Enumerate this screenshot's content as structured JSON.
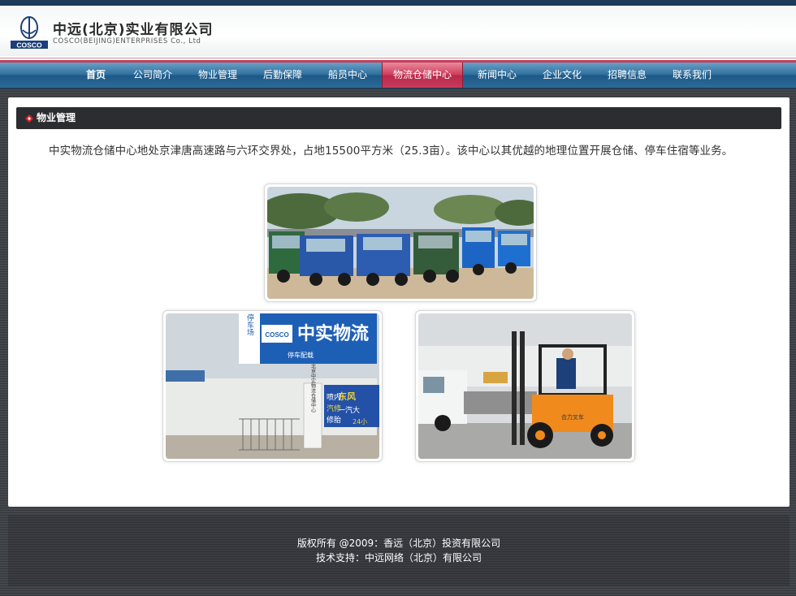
{
  "header": {
    "company_name_cn": "中远(北京)实业有限公司",
    "company_name_en": "COSCO(BEIJING)ENTERPRISES Co., Ltd",
    "logo_text": "COSCO"
  },
  "nav": {
    "items": [
      {
        "label": "首页"
      },
      {
        "label": "公司简介"
      },
      {
        "label": "物业管理"
      },
      {
        "label": "后勤保障"
      },
      {
        "label": "船员中心"
      },
      {
        "label": "物流仓储中心"
      },
      {
        "label": "新闻中心"
      },
      {
        "label": "企业文化"
      },
      {
        "label": "招聘信息"
      },
      {
        "label": "联系我们"
      }
    ],
    "active": "物流仓储中心",
    "active_color": "#c83b5b",
    "bar_color": "#2c6b98"
  },
  "section": {
    "title": "物业管理",
    "icon": "red-diamond-bullet-icon",
    "intro": "中实物流仓储中心地处京津唐高速路与六环交界处，占地15500平方米（25.3亩）。该中心以其优越的地理位置开展仓储、停车住宿等业务。"
  },
  "photos": {
    "truck_sign": "中实物流",
    "parking_sign": "停车场",
    "sign_logo": "COSCO",
    "sign_subtitle": "停车配载",
    "shop_sign_1": "喷内",
    "shop_sign_2": "东风",
    "shop_sign_3": "汽修",
    "shop_sign_4": "一汽大",
    "shop_sign_5": "修胎",
    "shop_sign_6": "24小",
    "vertical_sign": "北京中实物流仓储中心",
    "forklift_text": "合力叉车"
  },
  "footer": {
    "copyright": "版权所有 @2009：香远（北京）投资有限公司",
    "support": "技术支持：中远网络（北京）有限公司"
  }
}
